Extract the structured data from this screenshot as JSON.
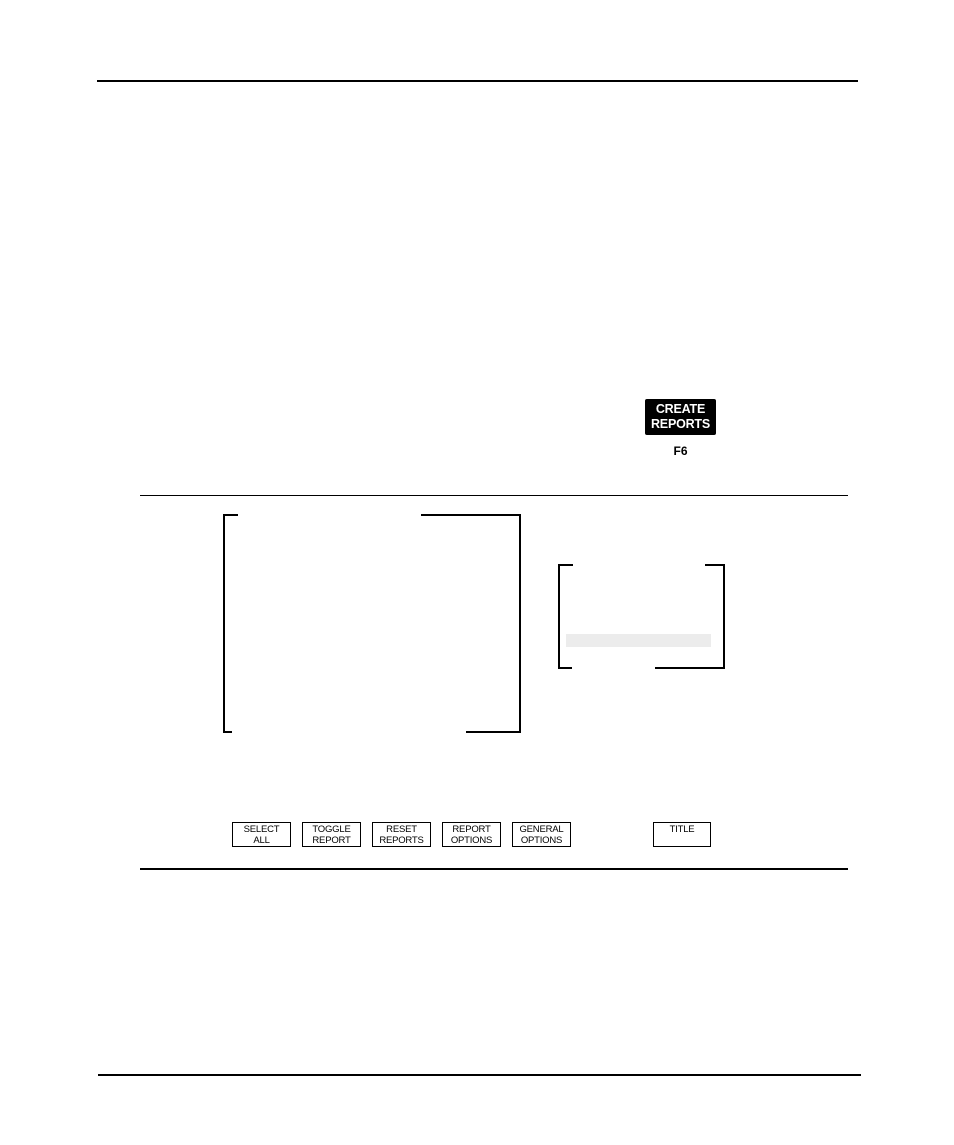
{
  "function_key": {
    "label_line1": "CREATE",
    "label_line2": "REPORTS",
    "key_name": "F6"
  },
  "report_list": {
    "items": []
  },
  "option_list": {
    "items": [],
    "highlight_color": "#ececec"
  },
  "softkeys": [
    {
      "line1": "SELECT",
      "line2": "ALL"
    },
    {
      "line1": "TOGGLE",
      "line2": "REPORT"
    },
    {
      "line1": "RESET",
      "line2": "REPORTS"
    },
    {
      "line1": "REPORT",
      "line2": "OPTIONS"
    },
    {
      "line1": "GENERAL",
      "line2": "OPTIONS"
    },
    {
      "line1": "TITLE",
      "line2": ""
    }
  ]
}
